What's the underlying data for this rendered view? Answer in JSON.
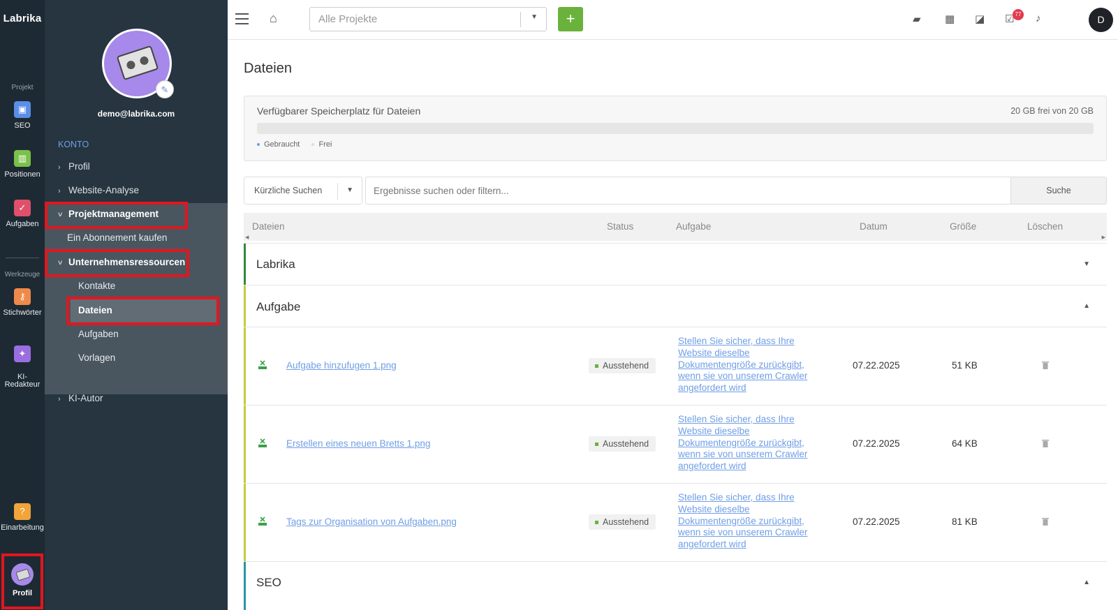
{
  "rail": {
    "logo": "Labrika",
    "group_project": "Projekt",
    "items": [
      {
        "label": "SEO",
        "color": "#5b8ee8"
      },
      {
        "label": "Positionen",
        "color": "#7ac14a"
      },
      {
        "label": "Aufgaben",
        "color": "#e0506a"
      }
    ],
    "group_tools": "Werkzeuge",
    "tools": [
      {
        "label": "Stichwörter",
        "color": "#ef8a4a"
      },
      {
        "label": "KI-\nRedakteur",
        "color": "#9a6ee0"
      }
    ],
    "onboarding": {
      "label": "Einarbeitung",
      "color": "#f0a43a"
    },
    "profile": {
      "label": "Profil"
    }
  },
  "sidebar": {
    "email": "demo@labrika.com",
    "section": "KONTO",
    "nav": {
      "profil": "Profil",
      "website_analyse": "Website-Analyse",
      "projektmanagement": "Projektmanagement",
      "abonnement": "Ein Abonnement kaufen",
      "unternehmen": "Unternehmensressourcen",
      "kontakte": "Kontakte",
      "dateien": "Dateien",
      "aufgaben": "Aufgaben",
      "vorlagen": "Vorlagen",
      "ki_autor": "KI-Autor"
    }
  },
  "topbar": {
    "project_select": "Alle Projekte",
    "badge_count": "77",
    "user_initial": "D",
    "add_color": "#6ab23c"
  },
  "main": {
    "title": "Dateien",
    "storage": {
      "label": "Verfügbarer Speicherplatz für Dateien",
      "free_text": "20 GB frei von 20 GB",
      "used_fraction": 0,
      "legend_used": "Gebraucht",
      "legend_free": "Frei"
    },
    "search": {
      "recent": "Kürzliche Suchen",
      "placeholder": "Ergebnisse suchen oder filtern...",
      "button": "Suche"
    },
    "columns": {
      "files": "Dateien",
      "status": "Status",
      "task": "Aufgabe",
      "date": "Datum",
      "size": "Größe",
      "delete": "Löschen"
    },
    "groups": {
      "labrika": {
        "name": "Labrika",
        "color": "#2f8a3c"
      },
      "aufgabe": {
        "name": "Aufgabe",
        "color": "#c3cc3a"
      },
      "seo": {
        "name": "SEO",
        "color": "#2a95a6"
      }
    },
    "rows": [
      {
        "file": "Aufgabe hinzufugen 1.png",
        "status": "Ausstehend",
        "task": "Stellen Sie sicher, dass Ihre Website dieselbe Dokumentengröße zurückgibt, wenn sie von unserem Crawler angefordert wird",
        "date": "07.22.2025",
        "size": "51 KB"
      },
      {
        "file": "Erstellen eines neuen Bretts 1.png",
        "status": "Ausstehend",
        "task": "Stellen Sie sicher, dass Ihre Website dieselbe Dokumentengröße zurückgibt, wenn sie von unserem Crawler angefordert wird",
        "date": "07.22.2025",
        "size": "64 KB"
      },
      {
        "file": "Tags zur Organisation von Aufgaben.png",
        "status": "Ausstehend",
        "task": "Stellen Sie sicher, dass Ihre Website dieselbe Dokumentengröße zurückgibt, wenn sie von unserem Crawler angefordert wird",
        "date": "07.22.2025",
        "size": "81 KB"
      }
    ]
  }
}
